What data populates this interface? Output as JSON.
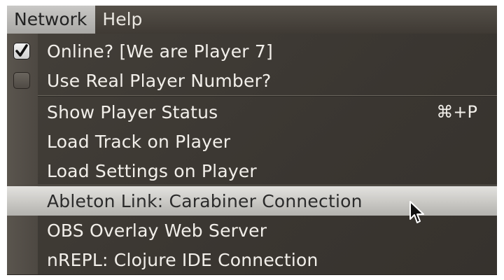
{
  "menubar": {
    "items": [
      {
        "label": "Network",
        "active": true
      },
      {
        "label": "Help",
        "active": false
      }
    ]
  },
  "menu": {
    "items": [
      {
        "label": "Online?  [We are Player 7]",
        "checkbox": true,
        "checked": true,
        "shortcut": ""
      },
      {
        "label": "Use Real Player Number?",
        "checkbox": true,
        "checked": false,
        "shortcut": ""
      },
      {
        "label": "Show Player Status",
        "checkbox": false,
        "shortcut": "⌘+P"
      },
      {
        "label": "Load Track on Player",
        "checkbox": false,
        "shortcut": ""
      },
      {
        "label": "Load Settings on Player",
        "checkbox": false,
        "shortcut": ""
      },
      {
        "label": "Ableton Link: Carabiner Connection",
        "checkbox": false,
        "shortcut": "",
        "highlighted": true
      },
      {
        "label": "OBS Overlay Web Server",
        "checkbox": false,
        "shortcut": ""
      },
      {
        "label": "nREPL: Clojure IDE Connection",
        "checkbox": false,
        "shortcut": ""
      }
    ]
  },
  "colors": {
    "menu_bg": "#3e3a34",
    "gutter": "#544f48",
    "highlight": "#c9c8c4",
    "text": "#f2efea"
  },
  "icons": [
    "checkmark-icon",
    "mouse-pointer-icon"
  ]
}
